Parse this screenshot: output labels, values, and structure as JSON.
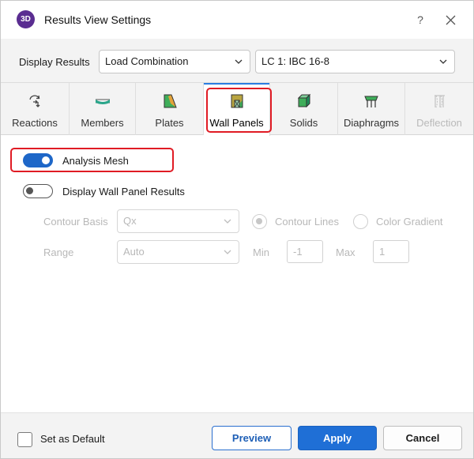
{
  "window": {
    "logo_text": "3D",
    "title": "Results View Settings",
    "help": "?"
  },
  "display_results": {
    "label": "Display Results",
    "type_value": "Load Combination",
    "combo_value": "LC 1: IBC 16-8"
  },
  "tabs": [
    {
      "label": "Reactions",
      "icon": "reactions-icon"
    },
    {
      "label": "Members",
      "icon": "members-icon"
    },
    {
      "label": "Plates",
      "icon": "plates-icon"
    },
    {
      "label": "Wall Panels",
      "icon": "wall-panels-icon",
      "active": true
    },
    {
      "label": "Solids",
      "icon": "solids-icon"
    },
    {
      "label": "Diaphragms",
      "icon": "diaphragms-icon"
    },
    {
      "label": "Deflection",
      "icon": "deflection-icon",
      "disabled": true
    }
  ],
  "analysis_mesh": {
    "label": "Analysis Mesh",
    "on": true
  },
  "wall_panel_results": {
    "label": "Display Wall Panel Results",
    "on": false
  },
  "contour": {
    "basis_label": "Contour Basis",
    "basis_value": "Qx",
    "lines_label": "Contour Lines",
    "gradient_label": "Color Gradient"
  },
  "range": {
    "label": "Range",
    "value": "Auto",
    "min_label": "Min",
    "min_value": "-1",
    "max_label": "Max",
    "max_value": "1"
  },
  "footer": {
    "default_label": "Set as Default",
    "preview": "Preview",
    "apply": "Apply",
    "cancel": "Cancel"
  },
  "colors": {
    "accent": "#1f6fd6",
    "highlight": "#e01b24",
    "logo": "#5a2d91"
  }
}
